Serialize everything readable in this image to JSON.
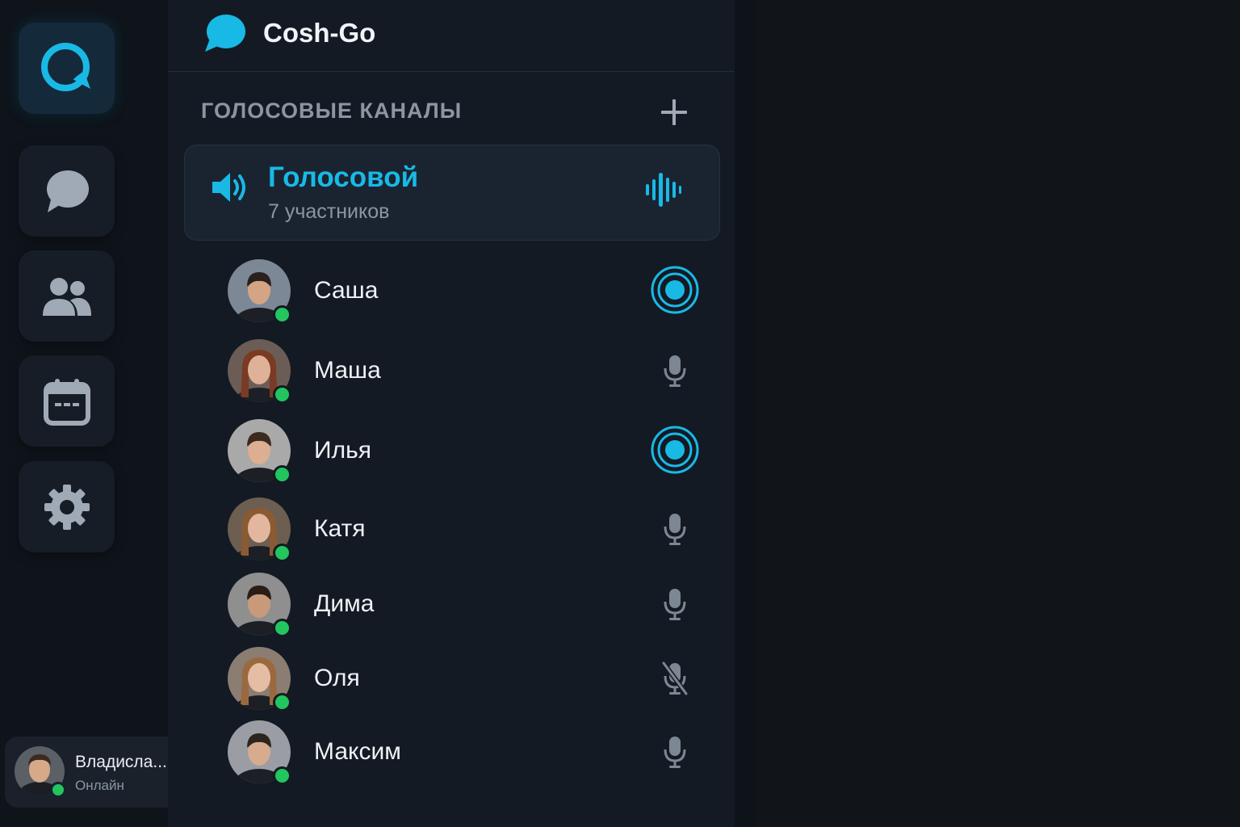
{
  "app": {
    "title": "Cosh-Go"
  },
  "rail": {
    "items": [
      {
        "icon": "logo-chat-icon",
        "active": true
      },
      {
        "icon": "chat-bubble-icon",
        "active": false
      },
      {
        "icon": "users-icon",
        "active": false
      },
      {
        "icon": "calendar-icon",
        "active": false
      },
      {
        "icon": "gear-icon",
        "active": false
      }
    ]
  },
  "section": {
    "title": "ГОЛОСОВЫЕ КАНАЛЫ",
    "add_icon": "plus-icon"
  },
  "channel": {
    "name": "Голосовой",
    "count": "7 участников",
    "icon": "speaker-icon",
    "activity_icon": "sound-wave-icon"
  },
  "members": [
    {
      "name": "Саша",
      "status": "speaking",
      "online": true
    },
    {
      "name": "Маша",
      "status": "mic",
      "online": true
    },
    {
      "name": "Илья",
      "status": "speaking",
      "online": true
    },
    {
      "name": "Катя",
      "status": "mic",
      "online": true
    },
    {
      "name": "Дима",
      "status": "mic",
      "online": true
    },
    {
      "name": "Оля",
      "status": "muted",
      "online": true
    },
    {
      "name": "Максим",
      "status": "mic",
      "online": true
    }
  ],
  "current_user": {
    "name": "Владисла...",
    "status": "Онлайн"
  },
  "colors": {
    "accent": "#19b9e6",
    "online": "#22c55e",
    "background": "#10151c",
    "panel": "#131a23"
  }
}
